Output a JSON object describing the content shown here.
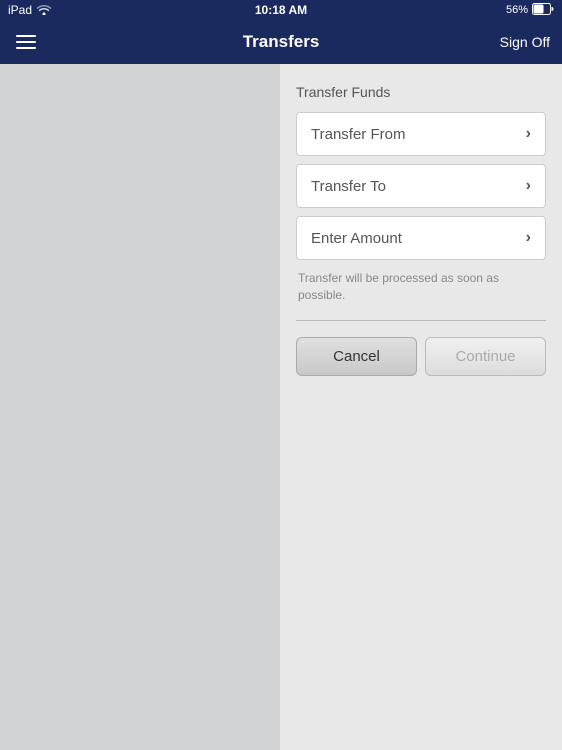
{
  "statusBar": {
    "device": "iPad",
    "wifi": "wifi-icon",
    "time": "10:18 AM",
    "battery_percent": "56%",
    "battery_icon": "battery-icon"
  },
  "navBar": {
    "menu_icon": "menu-icon",
    "title": "Transfers",
    "sign_off_label": "Sign Off"
  },
  "content": {
    "section_title": "Transfer Funds",
    "transfer_from_label": "Transfer From",
    "transfer_to_label": "Transfer To",
    "enter_amount_label": "Enter Amount",
    "info_text": "Transfer will be processed as soon as possible.",
    "cancel_button": "Cancel",
    "continue_button": "Continue"
  }
}
